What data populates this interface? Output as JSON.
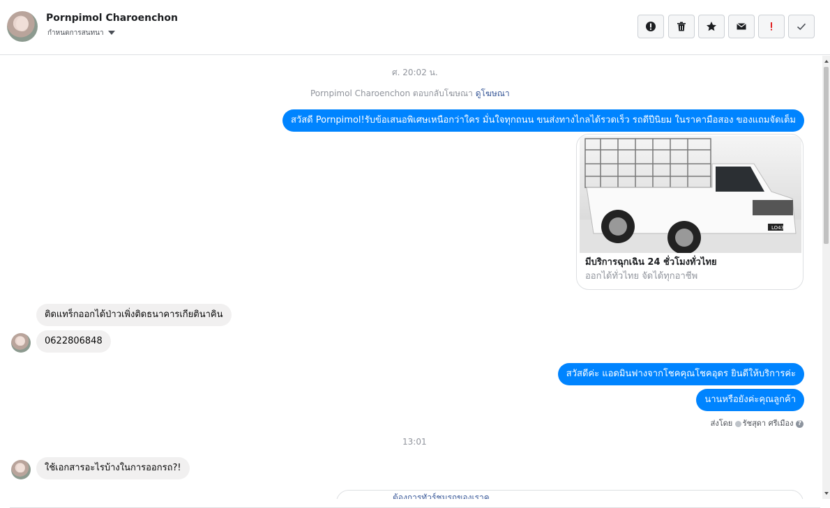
{
  "header": {
    "name": "Pornpimol Charoenchon",
    "subtitle": "กำหนดการสนทนา",
    "actions": [
      {
        "icon": "alert-circle-icon",
        "name": "report-button"
      },
      {
        "icon": "trash-icon",
        "name": "delete-button"
      },
      {
        "icon": "star-icon",
        "name": "star-button"
      },
      {
        "icon": "envelope-icon",
        "name": "mark-unread-button"
      },
      {
        "icon": "exclamation-icon",
        "name": "spam-button"
      },
      {
        "icon": "check-icon",
        "name": "done-button"
      }
    ]
  },
  "chat": {
    "timestamp1": "ศ. 20:02 น.",
    "ad_reply": {
      "text": "Pornpimol Charoenchon ตอบกลับโฆษณา",
      "link": "ดูโฆษณา"
    },
    "msg1": "สวัสดี Pornpimol!รับข้อเสนอพิเศษเหนือกว่าใคร มั่นใจทุกถนน ขนส่งทางไกลได้รวดเร็ว รถดีปีนิยม ในราคามือสอง ของแถมจัดเต็ม",
    "card": {
      "title": "มีบริการฉุกเฉิน 24 ชั่วโมงทั่วไทย",
      "subtitle": "ออกได้ทั่วไทย จัดได้ทุกอาชีพ",
      "plate": "LO43"
    },
    "in1": "ติดแทร็กออกได้ป่าวเพิ่งติดธนาคารเกียตินาคิน",
    "in2": "0622806848",
    "out2": "สวัสดีค่ะ แอดมินฟางจากโชคคุณโชคอุดร ยินดีให้บริการค่ะ",
    "out3": "นานหรือยังค่ะคุณลูกค้า",
    "sent_by": {
      "prefix": "ส่งโดย",
      "name": "รัชสุดา ศรีเมือง",
      "help": "?"
    },
    "timestamp2": "13:01",
    "in3": "ใช้เอกสารอะไรบ้างในการออกรถ?!",
    "partial_card": "ต้องการทัวร์ชมรถของเราค"
  },
  "colors": {
    "outgoing": "#0084ff",
    "incoming": "#f1f0f0",
    "link": "#385898",
    "muted": "#90949c"
  }
}
